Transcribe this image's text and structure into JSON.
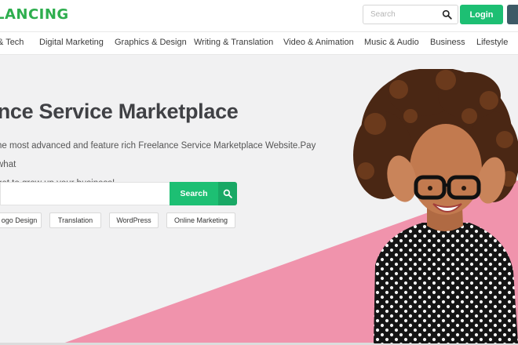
{
  "header": {
    "logo": "LANCING",
    "search_placeholder": "Search",
    "login_label": "Login"
  },
  "nav": {
    "items": [
      "& Tech",
      "Digital Marketing",
      "Graphics & Design",
      "Writing & Translation",
      "Video & Animation",
      "Music & Audio",
      "Business",
      "Lifestyle"
    ]
  },
  "hero": {
    "title": "ance Service Marketplace",
    "subtitle_line1": "he most advanced and feature rich Freelance Service Marketplace Website.Pay what",
    "subtitle_line2": "get to grow up your business!",
    "search_placeholder": "",
    "search_button": "Search",
    "tags": [
      "ogo Design",
      "Translation",
      "WordPress",
      "Online Marketing"
    ]
  },
  "colors": {
    "brand_green": "#1dbf73",
    "logo_green": "#2eae4e",
    "pink_accent": "#f093ac",
    "hero_bg": "#f1f1f2"
  },
  "icons": {
    "search": "search-icon",
    "hero_search": "search-icon"
  }
}
